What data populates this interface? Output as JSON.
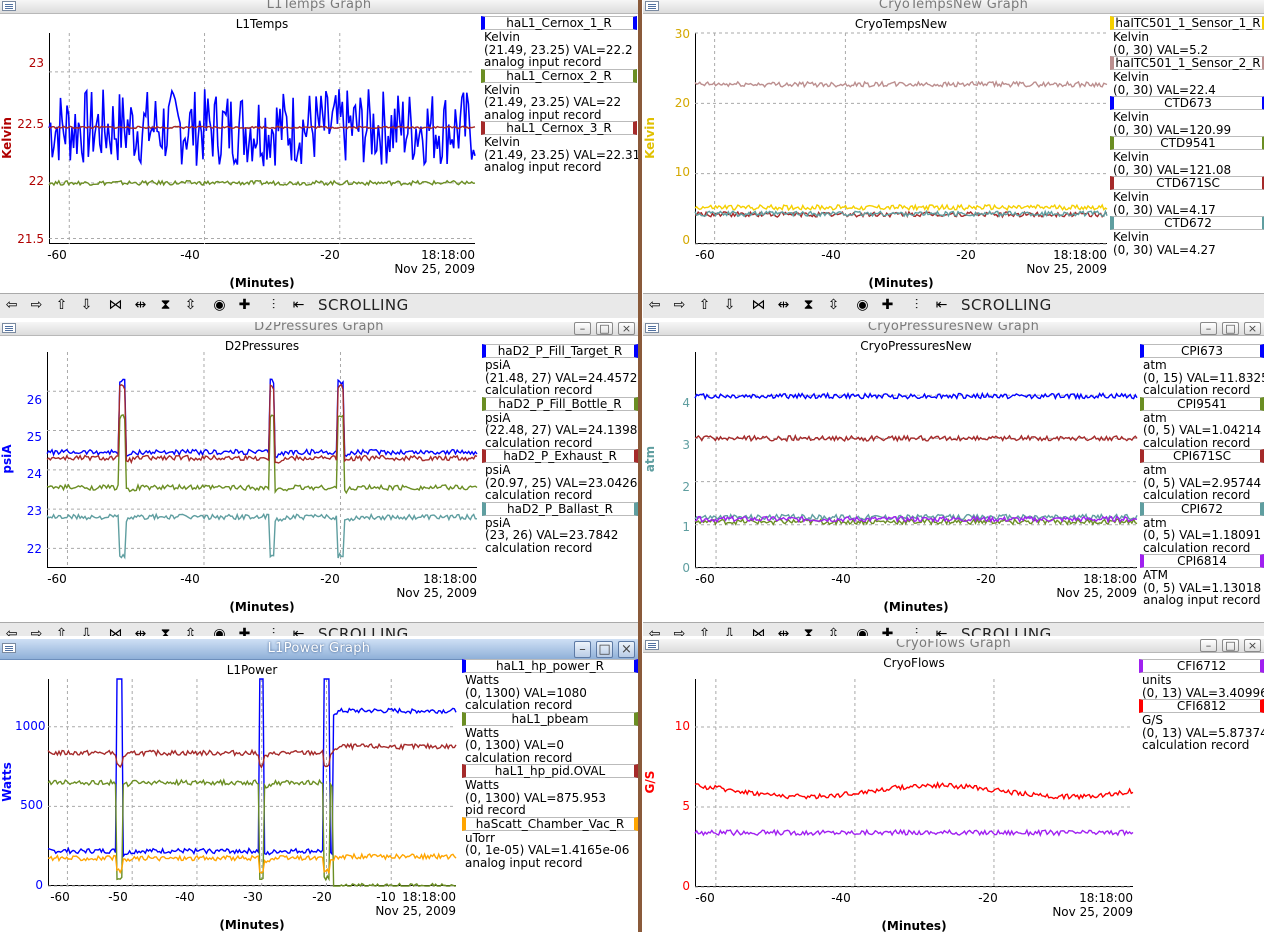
{
  "windows": [
    {
      "id": "l1temps",
      "window_title": "L1Temps Graph",
      "plot_title": "L1Temps",
      "ylabel": "Kelvin",
      "ylabel_color": "#b00000",
      "xlabel": "(Minutes)",
      "timestamp": [
        "18:18:00",
        "Nov 25, 2009"
      ],
      "yticks": [
        "23",
        "22.5",
        "22",
        "21.5"
      ],
      "xticks": [
        "-60",
        "-40",
        "-20"
      ],
      "legend": [
        {
          "name": "haL1_Cernox_1_R",
          "color": "#0000ff",
          "lines": [
            "Kelvin",
            "(21.49, 23.25) VAL=22.2",
            "analog input record"
          ]
        },
        {
          "name": "haL1_Cernox_2_R",
          "color": "#6b8e23",
          "lines": [
            "Kelvin",
            "(21.49, 23.25) VAL=22",
            "analog input record"
          ]
        },
        {
          "name": "haL1_Cernox_3_R",
          "color": "#a52a2a",
          "lines": [
            "Kelvin",
            "(21.49, 23.25) VAL=22.31",
            "analog input record"
          ]
        }
      ],
      "toolbar_text": "SCROLLING"
    },
    {
      "id": "cryotemps",
      "window_title": "CryoTempsNew Graph",
      "plot_title": "CryoTempsNew",
      "ylabel": "Kelvin",
      "ylabel_color": "#e0c000",
      "xlabel": "(Minutes)",
      "timestamp": [
        "18:18:00",
        "Nov 25, 2009"
      ],
      "yticks": [
        "30",
        "20",
        "10",
        "0"
      ],
      "xticks": [
        "-60",
        "-40",
        "-20"
      ],
      "legend": [
        {
          "name": "haITC501_1_Sensor_1_R",
          "color": "#f5d000",
          "lines": [
            "Kelvin",
            "(0, 30) VAL=5.2"
          ]
        },
        {
          "name": "haITC501_1_Sensor_2_R",
          "color": "#bc8f8f",
          "lines": [
            "Kelvin",
            "(0, 30) VAL=22.4"
          ]
        },
        {
          "name": "CTD673",
          "color": "#0000ff",
          "lines": [
            "Kelvin",
            "(0, 30) VAL=120.99"
          ]
        },
        {
          "name": "CTD9541",
          "color": "#6b8e23",
          "lines": [
            "Kelvin",
            "(0, 30) VAL=121.08"
          ]
        },
        {
          "name": "CTD671SC",
          "color": "#a52a2a",
          "lines": [
            "Kelvin",
            "(0, 30) VAL=4.17"
          ]
        },
        {
          "name": "CTD672",
          "color": "#5f9ea0",
          "lines": [
            "Kelvin",
            "(0, 30) VAL=4.27"
          ]
        }
      ],
      "toolbar_text": "SCROLLING"
    },
    {
      "id": "d2press",
      "window_title": "D2Pressures Graph",
      "plot_title": "D2Pressures",
      "ylabel": "psiA",
      "ylabel_color": "#0000ff",
      "xlabel": "(Minutes)",
      "timestamp": [
        "18:18:00",
        "Nov 25, 2009"
      ],
      "yticks": [
        "26",
        "25",
        "24",
        "23",
        "22"
      ],
      "xticks": [
        "-60",
        "-40",
        "-20"
      ],
      "legend": [
        {
          "name": "haD2_P_Fill_Target_R",
          "color": "#0000ff",
          "lines": [
            "psiA",
            "(21.48, 27) VAL=24.4572",
            "calculation record"
          ]
        },
        {
          "name": "haD2_P_Fill_Bottle_R",
          "color": "#6b8e23",
          "lines": [
            "psiA",
            "(22.48, 27) VAL=24.1398",
            "calculation record"
          ]
        },
        {
          "name": "haD2_P_Exhaust_R",
          "color": "#a52a2a",
          "lines": [
            "psiA",
            "(20.97, 25) VAL=23.0426",
            "calculation record"
          ]
        },
        {
          "name": "haD2_P_Ballast_R",
          "color": "#5f9ea0",
          "lines": [
            "psiA",
            "(23, 26) VAL=23.7842",
            "calculation record"
          ]
        }
      ],
      "toolbar_text": "SCROLLING"
    },
    {
      "id": "cryopress",
      "window_title": "CryoPressuresNew Graph",
      "plot_title": "CryoPressuresNew",
      "ylabel": "atm",
      "ylabel_color": "#5f9ea0",
      "xlabel": "(Minutes)",
      "timestamp": [
        "18:18:00",
        "Nov 25, 2009"
      ],
      "yticks": [
        "4",
        "3",
        "2",
        "1",
        "0"
      ],
      "xticks": [
        "-60",
        "-40",
        "-20"
      ],
      "legend": [
        {
          "name": "CPI673",
          "color": "#0000ff",
          "lines": [
            "atm",
            "(0, 15) VAL=11.8325",
            "calculation record"
          ]
        },
        {
          "name": "CPI9541",
          "color": "#6b8e23",
          "lines": [
            "atm",
            "(0, 5) VAL=1.04214",
            "calculation record"
          ]
        },
        {
          "name": "CPI671SC",
          "color": "#a52a2a",
          "lines": [
            "atm",
            "(0, 5) VAL=2.95744",
            "calculation record"
          ]
        },
        {
          "name": "CPI672",
          "color": "#5f9ea0",
          "lines": [
            "atm",
            "(0, 5) VAL=1.18091",
            "calculation record"
          ]
        },
        {
          "name": "CPI6814",
          "color": "#a020f0",
          "lines": [
            "ATM",
            "(0, 5) VAL=1.13018",
            "analog input record"
          ]
        }
      ],
      "toolbar_text": "SCROLLING"
    },
    {
      "id": "l1power",
      "window_title": "L1Power Graph",
      "plot_title": "L1Power",
      "ylabel": "Watts",
      "ylabel_color": "#0000ff",
      "xlabel": "(Minutes)",
      "timestamp": [
        "18:18:00",
        "Nov 25, 2009"
      ],
      "yticks": [
        "1000",
        "500",
        "0"
      ],
      "xticks": [
        "-60",
        "-50",
        "-40",
        "-30",
        "-20",
        "-10"
      ],
      "legend": [
        {
          "name": "haL1_hp_power_R",
          "color": "#0000ff",
          "lines": [
            "Watts",
            "(0, 1300) VAL=1080",
            "calculation record"
          ]
        },
        {
          "name": "haL1_pbeam",
          "color": "#6b8e23",
          "lines": [
            "Watts",
            "(0, 1300) VAL=0",
            "calculation record"
          ]
        },
        {
          "name": "haL1_hp_pid.OVAL",
          "color": "#a52a2a",
          "lines": [
            "Watts",
            "(0, 1300) VAL=875.953",
            "pid record"
          ]
        },
        {
          "name": "haScatt_Chamber_Vac_R",
          "color": "#ffa500",
          "lines": [
            "uTorr",
            "(0, 1e-05) VAL=1.4165e-06",
            "analog input record"
          ]
        }
      ],
      "toolbar_text": ""
    },
    {
      "id": "cryoflows",
      "window_title": "CryoFlows Graph",
      "plot_title": "CryoFlows",
      "ylabel": "G/S",
      "ylabel_color": "#ff0000",
      "xlabel": "(Minutes)",
      "timestamp": [
        "18:18:00",
        "Nov 25, 2009"
      ],
      "yticks": [
        "10",
        "5",
        "0"
      ],
      "xticks": [
        "-60",
        "-40",
        "-20"
      ],
      "legend": [
        {
          "name": "CFI6712",
          "color": "#a020f0",
          "lines": [
            "units",
            "(0, 13) VAL=3.40996"
          ]
        },
        {
          "name": "CFI6812",
          "color": "#ff0000",
          "lines": [
            "G/S",
            "(0, 13) VAL=5.87374",
            "calculation record"
          ]
        }
      ],
      "toolbar_text": ""
    }
  ],
  "toolbar_icons": [
    "left-arrow",
    "right-arrow",
    "up-arrow",
    "down-arrow",
    "zoom-in-x",
    "zoom-out-x",
    "zoom-in-y",
    "zoom-out-y",
    "center",
    "add",
    "autoscale",
    "undo"
  ],
  "chart_data": [
    {
      "type": "line",
      "title": "L1Temps",
      "xlabel": "(Minutes)",
      "ylabel": "Kelvin",
      "xlim": [
        -63,
        0
      ],
      "ylim": [
        21.45,
        23.35
      ],
      "series": [
        {
          "name": "haL1_Cernox_1_R",
          "color": "#0000ff",
          "base": 22.5,
          "noise": 0.35
        },
        {
          "name": "haL1_Cernox_2_R",
          "color": "#6b8e23",
          "base": 22.0,
          "noise": 0.02
        },
        {
          "name": "haL1_Cernox_3_R",
          "color": "#a52a2a",
          "base": 22.5,
          "noise": 0.01
        }
      ]
    },
    {
      "type": "line",
      "title": "CryoTempsNew",
      "xlabel": "(Minutes)",
      "ylabel": "Kelvin",
      "xlim": [
        -63,
        0
      ],
      "ylim": [
        0,
        30
      ],
      "series": [
        {
          "name": "haITC501_1_Sensor_1_R",
          "color": "#f5d000",
          "base": 5.2
        },
        {
          "name": "haITC501_1_Sensor_2_R",
          "color": "#bc8f8f",
          "base": 22.7
        },
        {
          "name": "CTD671SC",
          "color": "#a52a2a",
          "base": 4.2
        },
        {
          "name": "CTD672",
          "color": "#5f9ea0",
          "base": 4.3
        }
      ]
    },
    {
      "type": "line",
      "title": "D2Pressures",
      "xlabel": "(Minutes)",
      "ylabel": "psiA",
      "xlim": [
        -63,
        0
      ],
      "ylim": [
        21.5,
        27
      ],
      "series": [
        {
          "name": "haD2_P_Fill_Target_R",
          "color": "#0000ff",
          "base": 24.45
        },
        {
          "name": "haD2_P_Fill_Bottle_R",
          "color": "#6b8e23",
          "base": 23.55
        },
        {
          "name": "haD2_P_Exhaust_R",
          "color": "#a52a2a",
          "base": 24.3
        },
        {
          "name": "haD2_P_Ballast_R",
          "color": "#5f9ea0",
          "base": 22.8
        }
      ]
    },
    {
      "type": "line",
      "title": "CryoPressuresNew",
      "xlabel": "(Minutes)",
      "ylabel": "atm",
      "xlim": [
        -63,
        0
      ],
      "ylim": [
        0,
        5
      ],
      "series": [
        {
          "name": "CPI673",
          "color": "#0000ff",
          "base": 3.98
        },
        {
          "name": "CPI671SC",
          "color": "#a52a2a",
          "base": 3.0
        },
        {
          "name": "CPI672",
          "color": "#5f9ea0",
          "base": 1.18
        },
        {
          "name": "CPI9541",
          "color": "#6b8e23",
          "base": 1.07
        },
        {
          "name": "CPI6814",
          "color": "#a020f0",
          "base": 1.13
        }
      ]
    },
    {
      "type": "line",
      "title": "L1Power",
      "xlabel": "(Minutes)",
      "ylabel": "Watts",
      "xlim": [
        -63,
        0
      ],
      "ylim": [
        0,
        1300
      ],
      "series": [
        {
          "name": "haL1_hp_power_R",
          "color": "#0000ff",
          "base": 1100
        },
        {
          "name": "haL1_pbeam",
          "color": "#6b8e23",
          "base": 650
        },
        {
          "name": "haL1_hp_pid.OVAL",
          "color": "#a52a2a",
          "base": 876
        },
        {
          "name": "haScatt_Chamber_Vac_R",
          "color": "#ffa500",
          "base": 175
        }
      ]
    },
    {
      "type": "line",
      "title": "CryoFlows",
      "xlabel": "(Minutes)",
      "ylabel": "G/S",
      "xlim": [
        -63,
        0
      ],
      "ylim": [
        0,
        13
      ],
      "series": [
        {
          "name": "CFI6812",
          "color": "#ff0000",
          "base": 6.0
        },
        {
          "name": "CFI6712",
          "color": "#a020f0",
          "base": 3.4
        }
      ]
    }
  ]
}
